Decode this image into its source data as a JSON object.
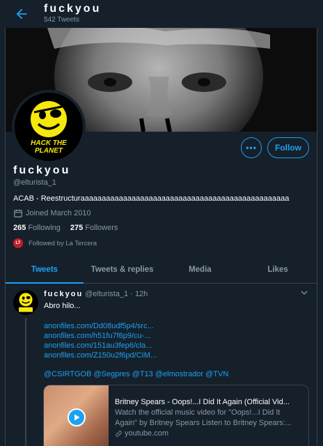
{
  "header": {
    "title": "fuckyou",
    "tweet_count": "542 Tweets"
  },
  "profile": {
    "name": "fuckyou",
    "handle": "@elturista_1",
    "bio": "ACAB - Reestructuraaaaaaaaaaaaaaaaaaaaaaaaaaaaaaaaaaaaaaaaaaaaaaaaa",
    "joined": "Joined March 2010",
    "following_count": "265",
    "following_label": "Following",
    "followers_count": "275",
    "followers_label": "Followers",
    "followed_by": "Followed by La Tercera",
    "followed_by_badge": "LT",
    "avatar_text_line1": "HACK THE",
    "avatar_text_line2": "PLANET",
    "more_label": "•••",
    "follow_label": "Follow"
  },
  "tabs": [
    {
      "label": "Tweets",
      "active": true
    },
    {
      "label": "Tweets & replies",
      "active": false
    },
    {
      "label": "Media",
      "active": false
    },
    {
      "label": "Likes",
      "active": false
    }
  ],
  "tweet": {
    "name": "fuckyou",
    "meta": "@elturista_1 · 12h",
    "text": "Abro hilo...",
    "links": [
      "anonfiles.com/Dd08udf5p4/src...",
      "anonfiles.com/h51fu7f6p9/cu-...",
      "anonfiles.com/151au3fep6/cla...",
      "anonfiles.com/Z150u2f6pd/CIM..."
    ],
    "mentions": "@CSIRTGOB @Segpres @T13 @elmostrador @TVN",
    "card": {
      "title": "Britney Spears - Oops!...I Did It Again (Official Vid...",
      "description": "Watch the official music video for \"Oops!...I Did It Again\" by Britney Spears Listen to Britney Spears:...",
      "domain": "youtube.com"
    }
  },
  "colors": {
    "background": "#15202b",
    "accent": "#1da1f2",
    "muted": "#8899a6",
    "border": "#38444d",
    "smiley": "#f5e80d"
  }
}
